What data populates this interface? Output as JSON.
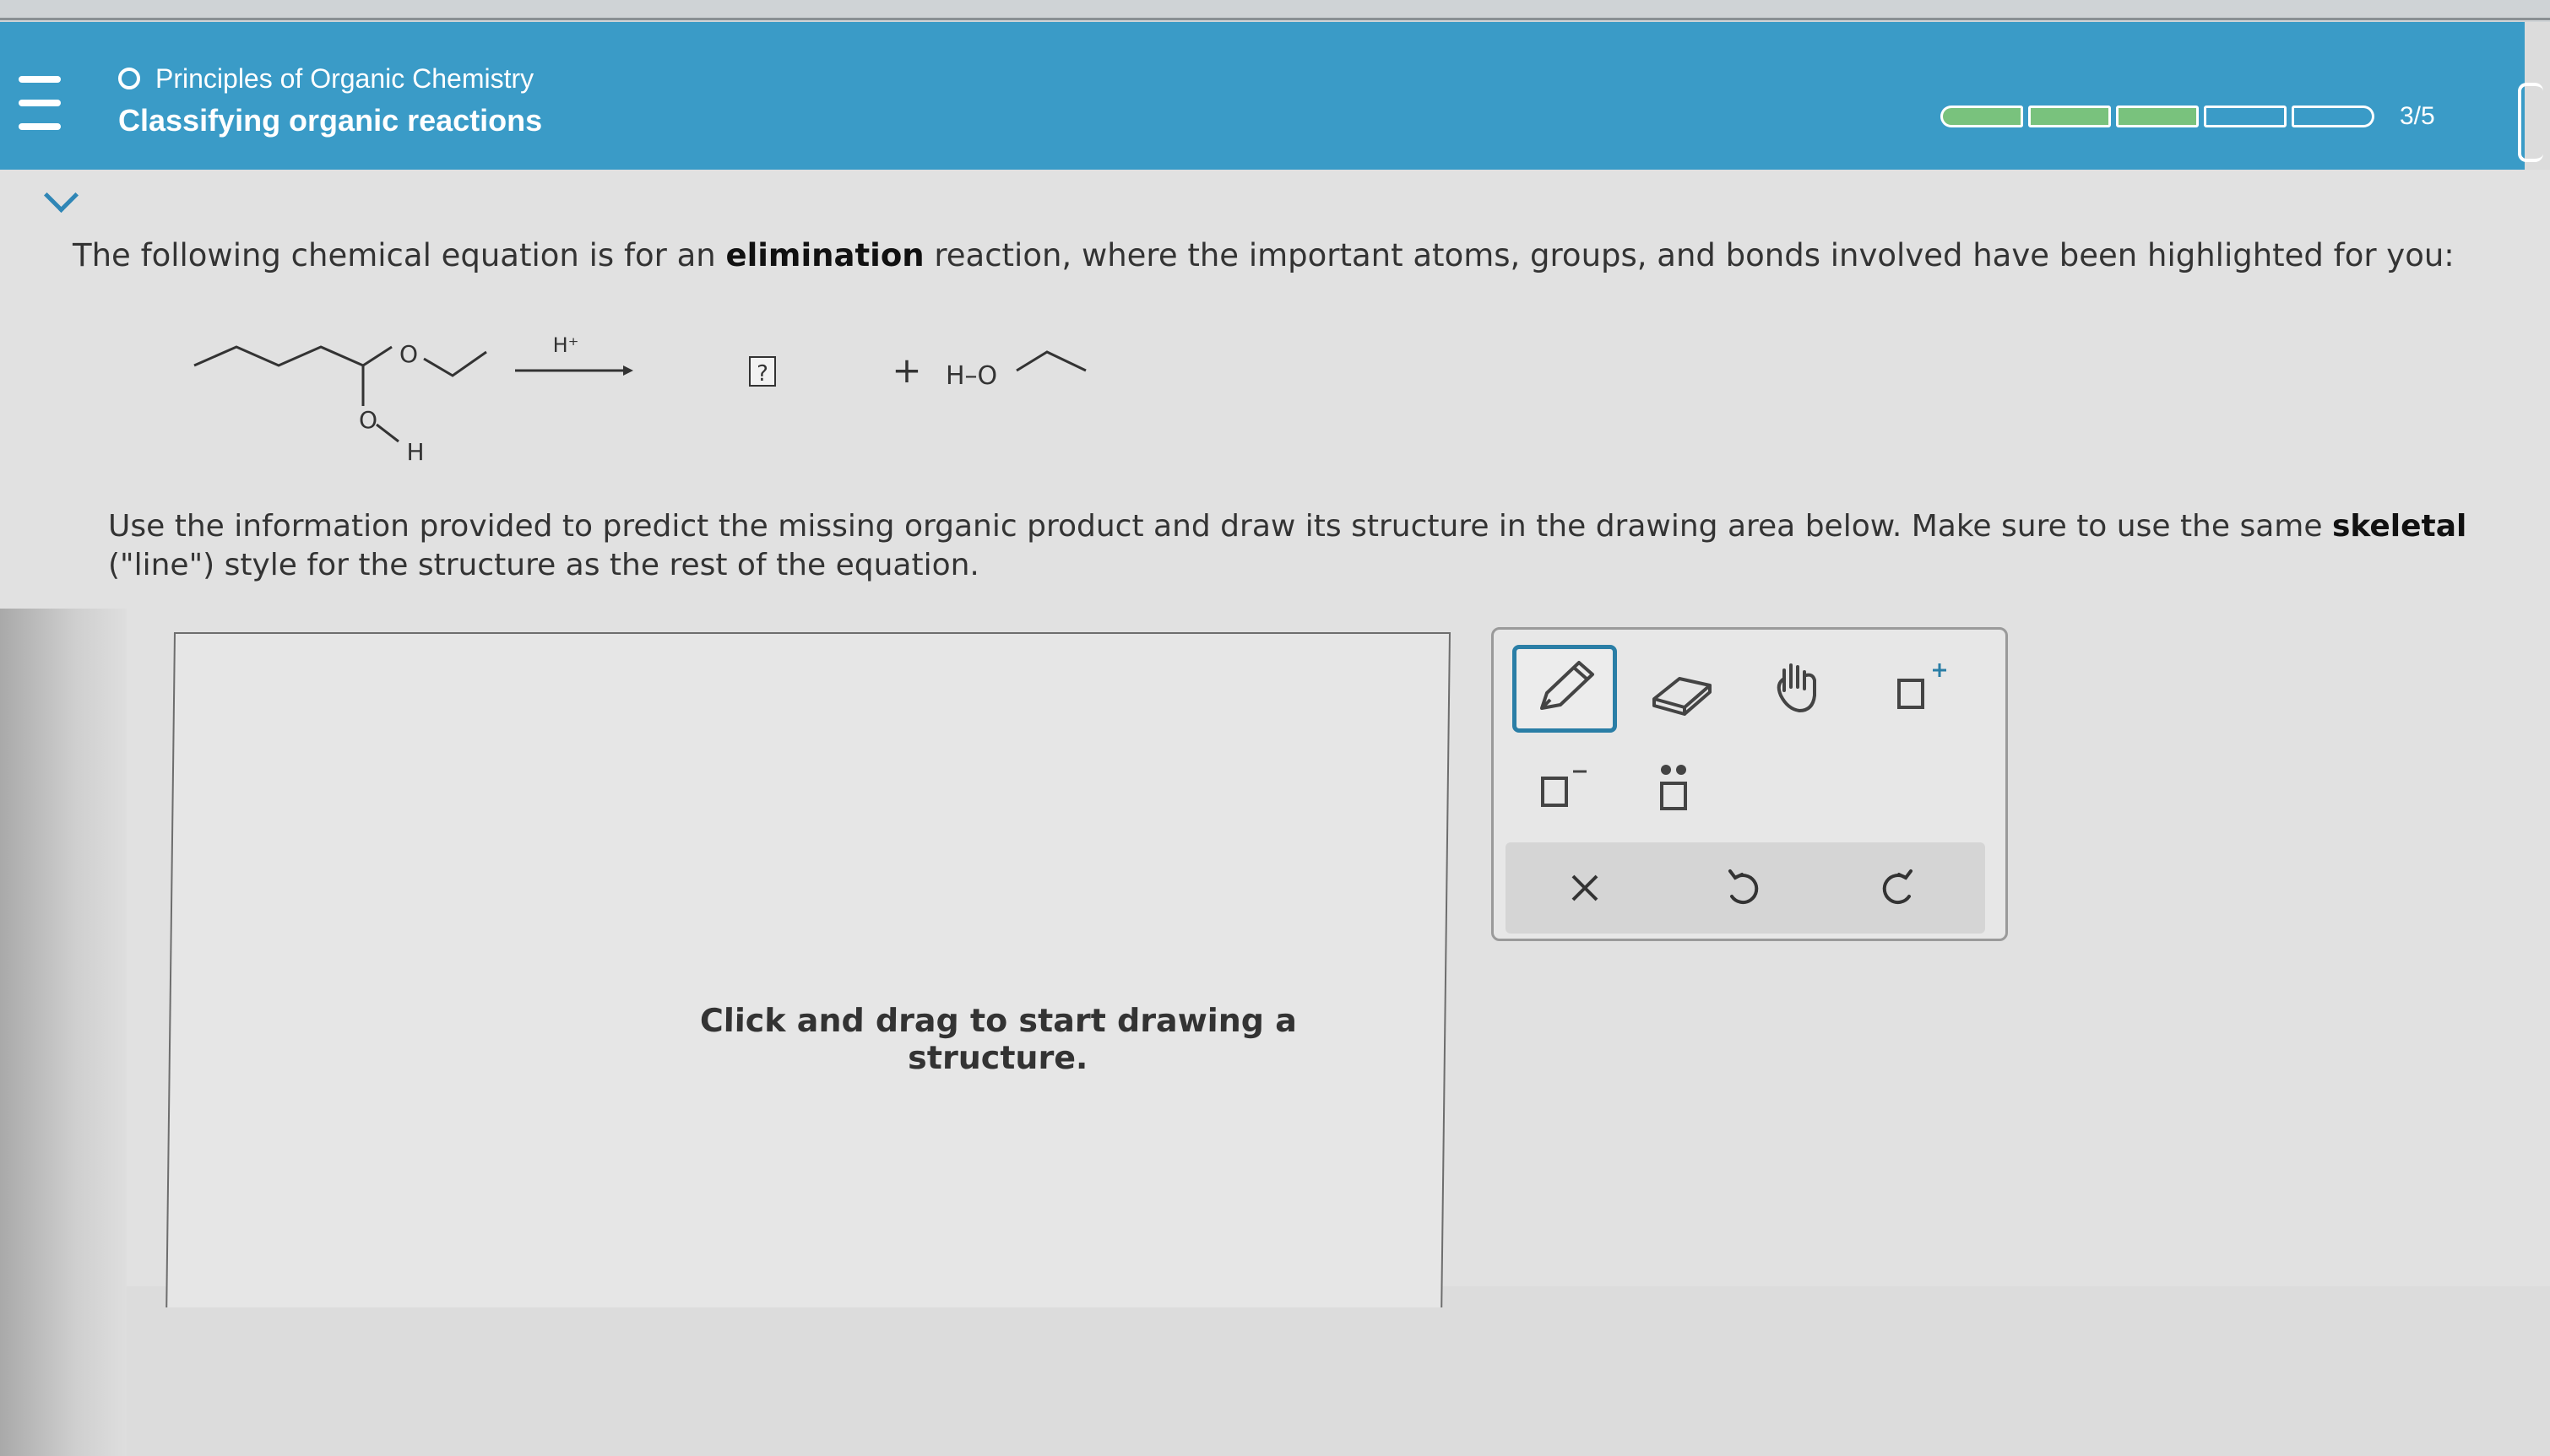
{
  "header": {
    "course_title": "Principles of Organic Chemistry",
    "topic_title": "Classifying organic reactions",
    "progress": {
      "completed": 3,
      "total": 5,
      "label": "3/5"
    }
  },
  "question": {
    "text_before": "The following chemical equation is for an ",
    "keyword": "elimination",
    "text_after": " reaction, where the important atoms, groups, and bonds involved have been highlighted for you:"
  },
  "equation": {
    "catalyst": "H⁺",
    "unknown_box": "?",
    "plus": "+",
    "byproduct_label": "H–O",
    "reactant_atoms": {
      "ring_oxygen": "O",
      "hydroxyl_oxygen": "O",
      "hydroxyl_hydrogen": "H"
    }
  },
  "instruction": {
    "text_before": "Use the information provided to predict the missing organic product and draw its structure in the drawing area below. Make sure to use the same ",
    "keyword": "skeletal",
    "text_after": " (\"line\") style for the structure as the rest of the equation."
  },
  "drawing_area": {
    "hint_line1": "Click and drag to start drawing a",
    "hint_line2": "structure."
  },
  "toolbox": {
    "tools": [
      "pencil-icon",
      "eraser-icon",
      "hand-icon",
      "positive-charge-icon",
      "negative-charge-icon",
      "lone-pair-icon"
    ],
    "actions": [
      "clear-icon",
      "undo-icon",
      "redo-icon"
    ],
    "active_tool": "pencil-icon",
    "accent_color": "#2a7ea6"
  },
  "colors": {
    "header_bg": "#3a9bc7",
    "progress_filled": "#79c27d",
    "link_blue": "#2f86b6"
  }
}
